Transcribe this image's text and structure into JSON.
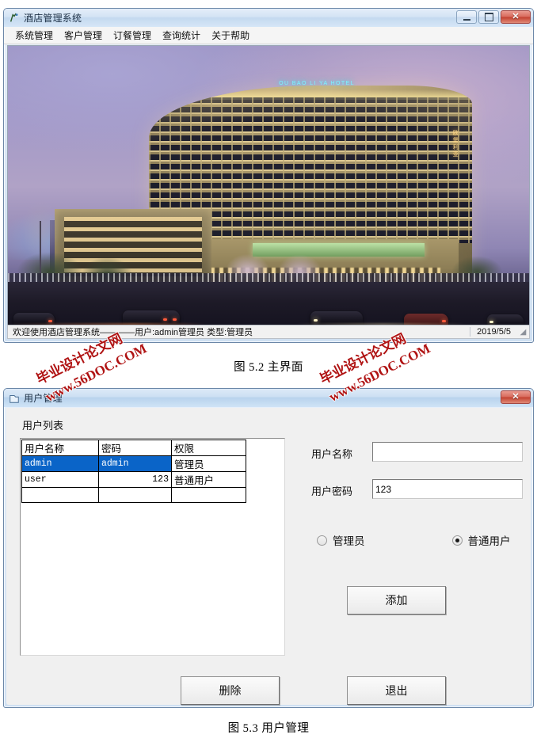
{
  "main_window": {
    "title": "酒店管理系统",
    "title_icon": "app-icon",
    "window_buttons": {
      "minimize": "minimize-icon",
      "maximize": "maximize-icon",
      "close": "✕"
    },
    "menu": [
      "系统管理",
      "客户管理",
      "订餐管理",
      "查询统计",
      "关于帮助"
    ],
    "photo": {
      "hotel_sign": "OU BAO LI YA HOTEL",
      "hotel_sign_vertical": "欧堡利亚"
    },
    "statusbar": {
      "message": "欢迎使用酒店管理系统————用户:admin管理员    类型:管理员",
      "date": "2019/5/5",
      "grip": "◢"
    }
  },
  "caption_1": "图 5.2 主界面",
  "user_window": {
    "title": "用户管理",
    "title_icon": "window-icon",
    "close_label": "✕",
    "section_label": "用户列表",
    "table": {
      "headers": [
        "用户名称",
        "密码",
        "权限"
      ],
      "rows": [
        {
          "name": "admin",
          "password": "admin",
          "role": "管理员",
          "selected": true,
          "password_numeric": false
        },
        {
          "name": "user",
          "password": "123",
          "role": "普通用户",
          "selected": false,
          "password_numeric": true
        },
        {
          "name": "",
          "password": "",
          "role": "",
          "selected": false,
          "password_numeric": false
        }
      ]
    },
    "form": {
      "name_label": "用户名称",
      "name_value": "",
      "name_placeholder": "",
      "password_label": "用户密码",
      "password_value": "123"
    },
    "roles": [
      {
        "label": "管理员",
        "checked": false
      },
      {
        "label": "普通用户",
        "checked": true
      }
    ],
    "buttons": {
      "add": "添加",
      "delete": "删除",
      "exit": "退出"
    }
  },
  "caption_2": "图 5.3 用户管理",
  "watermark": {
    "line1": "毕业设计论文网",
    "line2": "www.56DOC.COM",
    "color": "#b01313"
  }
}
